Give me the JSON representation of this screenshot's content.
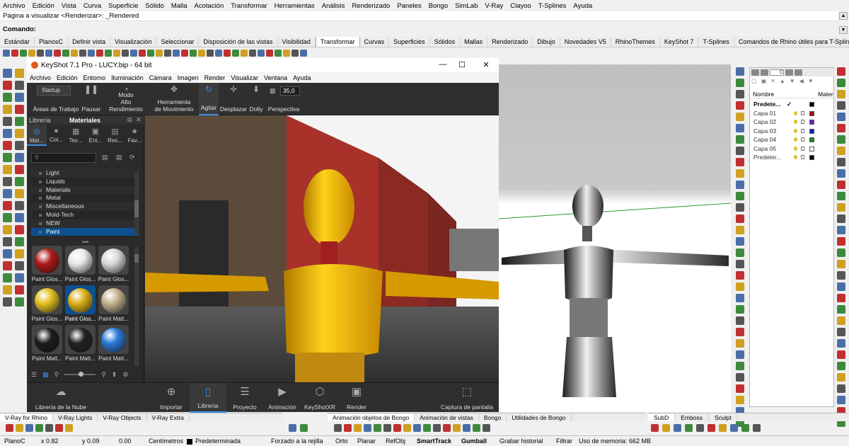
{
  "rhino": {
    "menu": [
      "Archivo",
      "Edición",
      "Vista",
      "Curva",
      "Superficie",
      "Sólido",
      "Malla",
      "Acotación",
      "Transformar",
      "Herramientas",
      "Análisis",
      "Renderizado",
      "Paneles",
      "Bongo",
      "SimLab",
      "V-Ray",
      "Clayoo",
      "T-Splines",
      "Ayuda"
    ],
    "command_history": "Página a visualizar <Renderizar>: _Rendered",
    "command_prompt": "Comando:",
    "tabs": [
      "Estándar",
      "PlanosC",
      "Definir vista",
      "Visualización",
      "Seleccionar",
      "Disposición de las vistas",
      "Visibilidad",
      "Transformar",
      "Curvas",
      "Superficies",
      "Sólidos",
      "Mallas",
      "Renderizado",
      "Dibujo",
      "Novedades V5",
      "RhinoThemes",
      "KeyShot 7",
      "T-Splines",
      "Comandos de Rhino útiles para T-Splines"
    ],
    "active_tab": "Transformar"
  },
  "keyshot": {
    "title": "KeyShot 7.1 Pro  -  LUCY.bip  - 64 bit",
    "menu": [
      "Archivo",
      "Edición",
      "Entorno",
      "Iluminación",
      "Cámara",
      "Imagen",
      "Render",
      "Visualizar",
      "Ventana",
      "Ayuda"
    ],
    "toolbar": {
      "startup": "Startup",
      "workspaces": "Áreas de Trabajo",
      "pause": "Pausar",
      "mode": "Modo",
      "mode2": "Alto Rendimiento",
      "motion": "Herramienta",
      "motion2": "de Movimiento",
      "tumble": "Agitar",
      "pan": "Desplazar",
      "dolly": "Dolly",
      "fov": "35,0",
      "perspective": "Perspectiva"
    },
    "library": {
      "tab_library": "Librería",
      "tab_materials": "Materiales",
      "subtabs": [
        "Mat...",
        "Col...",
        "Tex...",
        "Ent...",
        "Res...",
        "Fav..."
      ],
      "tree": [
        "Light",
        "Liquids",
        "Materials",
        "Metal",
        "Miscellaneous",
        "Mold-Tech",
        "NEW",
        "Paint"
      ],
      "selected": "Paint",
      "materials": [
        {
          "label": "Paint Glos...",
          "color": "#b01818"
        },
        {
          "label": "Paint Glos...",
          "color": "#e8e8e8"
        },
        {
          "label": "Paint Glos...",
          "color": "#d8d8d8"
        },
        {
          "label": "Paint Glos...",
          "color": "#e2c020"
        },
        {
          "label": "Paint Glos...",
          "color": "#dcb018"
        },
        {
          "label": "Paint Matt...",
          "color": "#c6b28e"
        },
        {
          "label": "Paint Matt...",
          "color": "#1c1c1c"
        },
        {
          "label": "Paint Matt...",
          "color": "#222222"
        },
        {
          "label": "Paint Matt...",
          "color": "#2a7ad8"
        }
      ]
    },
    "dock": {
      "cloud": "Librería de la Nube",
      "import": "Importar",
      "library": "Librería",
      "project": "Proyecto",
      "animation": "Animación",
      "xr": "KeyShotXR",
      "render": "Render",
      "screenshot": "Captura de pantalla"
    }
  },
  "layers": {
    "header_name": "Nombre",
    "header_mat": "Mater",
    "rows": [
      {
        "name": "Predete...",
        "bold": true,
        "color": "#000000"
      },
      {
        "name": "Capa 01",
        "color": "#a01010"
      },
      {
        "name": "Capa 02",
        "color": "#7a1ab8"
      },
      {
        "name": "Capa 03",
        "color": "#1020c8"
      },
      {
        "name": "Capa 04",
        "color": "#1a8a1a"
      },
      {
        "name": "Capa 05",
        "color": "#ffffff"
      },
      {
        "name": "Predeter...",
        "color": "#000000"
      }
    ]
  },
  "bottom_tabs": {
    "left": [
      "V-Ray for Rhino",
      "V-Ray Lights",
      "V-Ray Objects",
      "V-Ray Extra"
    ],
    "middle": [
      "Animación objetos de Bongo",
      "Animación de vistas",
      "Bongo",
      "Utilidades de Bongo"
    ],
    "right": [
      "SubD",
      "Emboss",
      "Sculpt"
    ]
  },
  "status": {
    "cplane": "PlanoC",
    "x": "x 0.82",
    "y": "y 0.09",
    "z": "0.00",
    "units": "Centímetros",
    "layer": "Predeterminada",
    "snap": "Forzado a la rejilla",
    "ortho": "Orto",
    "planar": "Planar",
    "osnap": "RefObj",
    "smarttrack": "SmartTrack",
    "gumball": "Gumball",
    "history": "Grabar historial",
    "filter": "Filtrar",
    "memory": "Uso de memoria: 662 MB"
  }
}
